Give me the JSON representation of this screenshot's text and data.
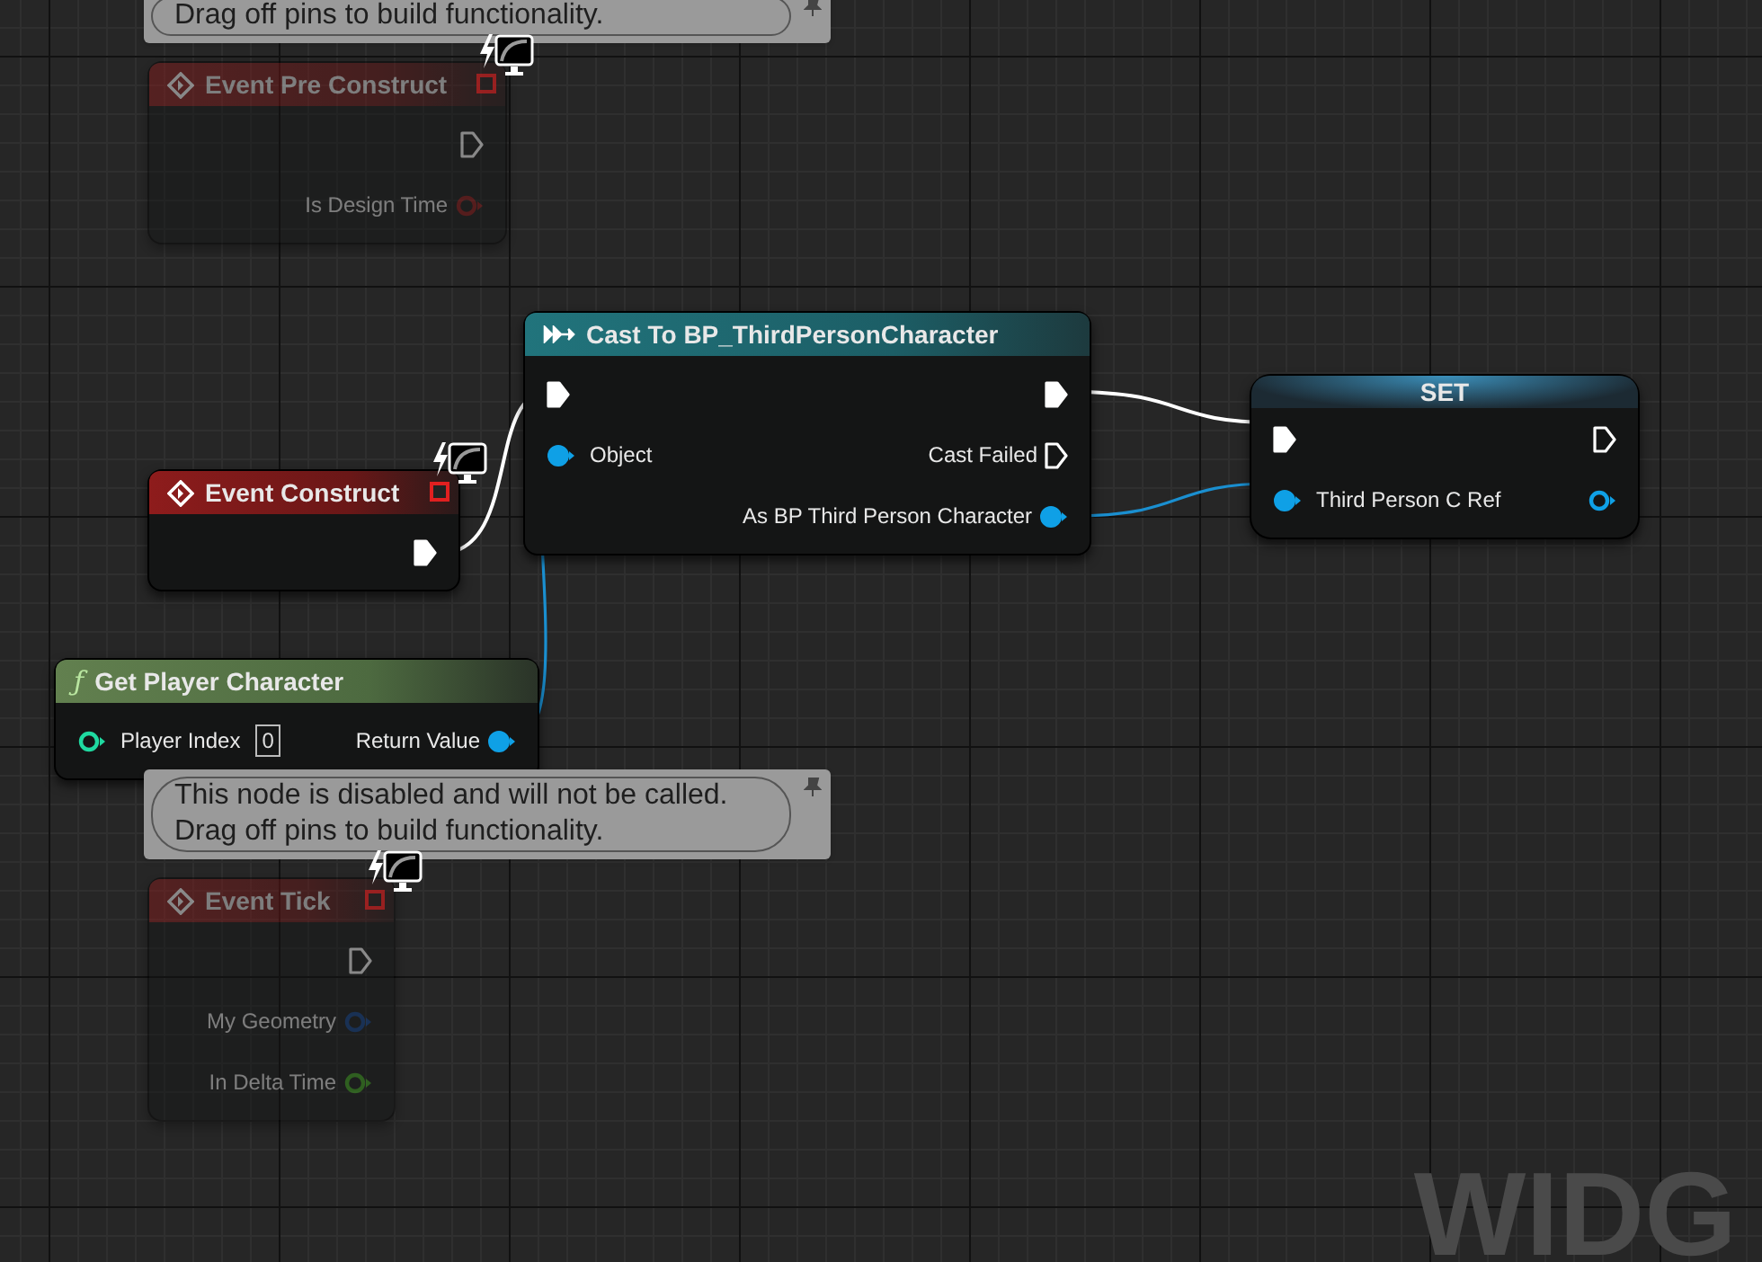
{
  "nodes": [
    {
      "kind": "event",
      "title": "Event Pre Construct",
      "disabled": true,
      "comment": "Drag off pins to build functionality.",
      "rows": [
        {
          "right": {
            "kind": "exec",
            "connected": false
          }
        },
        {
          "right": {
            "kind": "bool",
            "label": "Is Design Time",
            "connected": false
          }
        }
      ]
    },
    {
      "kind": "event",
      "title": "Event Construct",
      "disabled": false,
      "rows": [
        {
          "right": {
            "kind": "exec",
            "connected": true
          }
        }
      ]
    },
    {
      "kind": "function",
      "glyph": "ƒ",
      "title": "Get Player Character",
      "disabled": false,
      "rows": [
        {
          "left": {
            "kind": "int",
            "label": "Player Index",
            "value": "0",
            "connected": false
          },
          "right": {
            "kind": "object",
            "label": "Return Value",
            "connected": true
          }
        }
      ]
    },
    {
      "kind": "cast",
      "title": "Cast To BP_ThirdPersonCharacter",
      "disabled": false,
      "rows": [
        {
          "left": {
            "kind": "exec",
            "connected": true
          },
          "right": {
            "kind": "exec",
            "connected": true
          }
        },
        {
          "left": {
            "kind": "object",
            "label": "Object",
            "connected": true
          },
          "right": {
            "kind": "exec",
            "label": "Cast Failed",
            "connected": false
          }
        },
        {
          "right": {
            "kind": "object",
            "label": "As BP Third Person Character",
            "connected": true
          }
        }
      ]
    },
    {
      "kind": "set",
      "title": "SET",
      "disabled": false,
      "rows": [
        {
          "left": {
            "kind": "exec",
            "connected": true
          },
          "right": {
            "kind": "exec",
            "connected": false
          }
        },
        {
          "left": {
            "kind": "object",
            "label": "Third Person C Ref",
            "connected": true
          },
          "right": {
            "kind": "object",
            "connected": false
          }
        }
      ]
    },
    {
      "kind": "event",
      "title": "Event Tick",
      "disabled": true,
      "comment": "This node is disabled and will not be called. Drag off pins to build functionality.",
      "rows": [
        {
          "right": {
            "kind": "exec",
            "connected": false
          }
        },
        {
          "right": {
            "kind": "struct",
            "label": "My Geometry",
            "connected": false
          }
        },
        {
          "right": {
            "kind": "float",
            "label": "In Delta Time",
            "connected": false
          }
        }
      ]
    }
  ],
  "corner_text": "WIDG"
}
